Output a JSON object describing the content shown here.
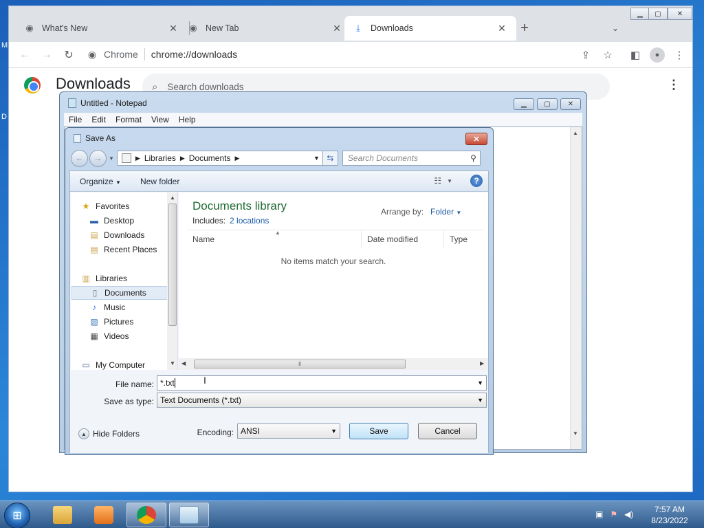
{
  "browser": {
    "tabs": [
      {
        "label": "What's New",
        "icon": "chrome-icon"
      },
      {
        "label": "New Tab",
        "icon": "chrome-icon"
      },
      {
        "label": "Downloads",
        "icon": "download-icon"
      }
    ],
    "omnibox": {
      "site_name": "Chrome",
      "url": "chrome://downloads"
    },
    "page": {
      "title": "Downloads",
      "search_placeholder": "Search downloads"
    }
  },
  "notepad": {
    "title": "Untitled - Notepad",
    "menu": [
      "File",
      "Edit",
      "Format",
      "View",
      "Help"
    ]
  },
  "save_dialog": {
    "title": "Save As",
    "breadcrumb": [
      "Libraries",
      "Documents"
    ],
    "search_placeholder": "Search Documents",
    "toolbar": {
      "organize": "Organize",
      "new_folder": "New folder"
    },
    "nav": {
      "favorites": "Favorites",
      "desktop": "Desktop",
      "downloads": "Downloads",
      "recent": "Recent Places",
      "libraries": "Libraries",
      "documents": "Documents",
      "music": "Music",
      "pictures": "Pictures",
      "videos": "Videos",
      "computer": "My Computer"
    },
    "library": {
      "title": "Documents library",
      "includes_label": "Includes:",
      "locations_link": "2 locations",
      "arrange_label": "Arrange by:",
      "arrange_value": "Folder"
    },
    "columns": [
      "Name",
      "Date modified",
      "Type"
    ],
    "empty_message": "No items match your search.",
    "file_name_label": "File name:",
    "file_name_value": "*.txt",
    "save_type_label": "Save as type:",
    "save_type_value": "Text Documents (*.txt)",
    "encoding_label": "Encoding:",
    "encoding_value": "ANSI",
    "hide_folders": "Hide Folders",
    "save_button": "Save",
    "cancel_button": "Cancel"
  },
  "taskbar": {
    "time": "7:57 AM",
    "date": "8/23/2022"
  },
  "colors": {
    "accent_green": "#1e6a33",
    "link_blue": "#1e5ba8"
  }
}
